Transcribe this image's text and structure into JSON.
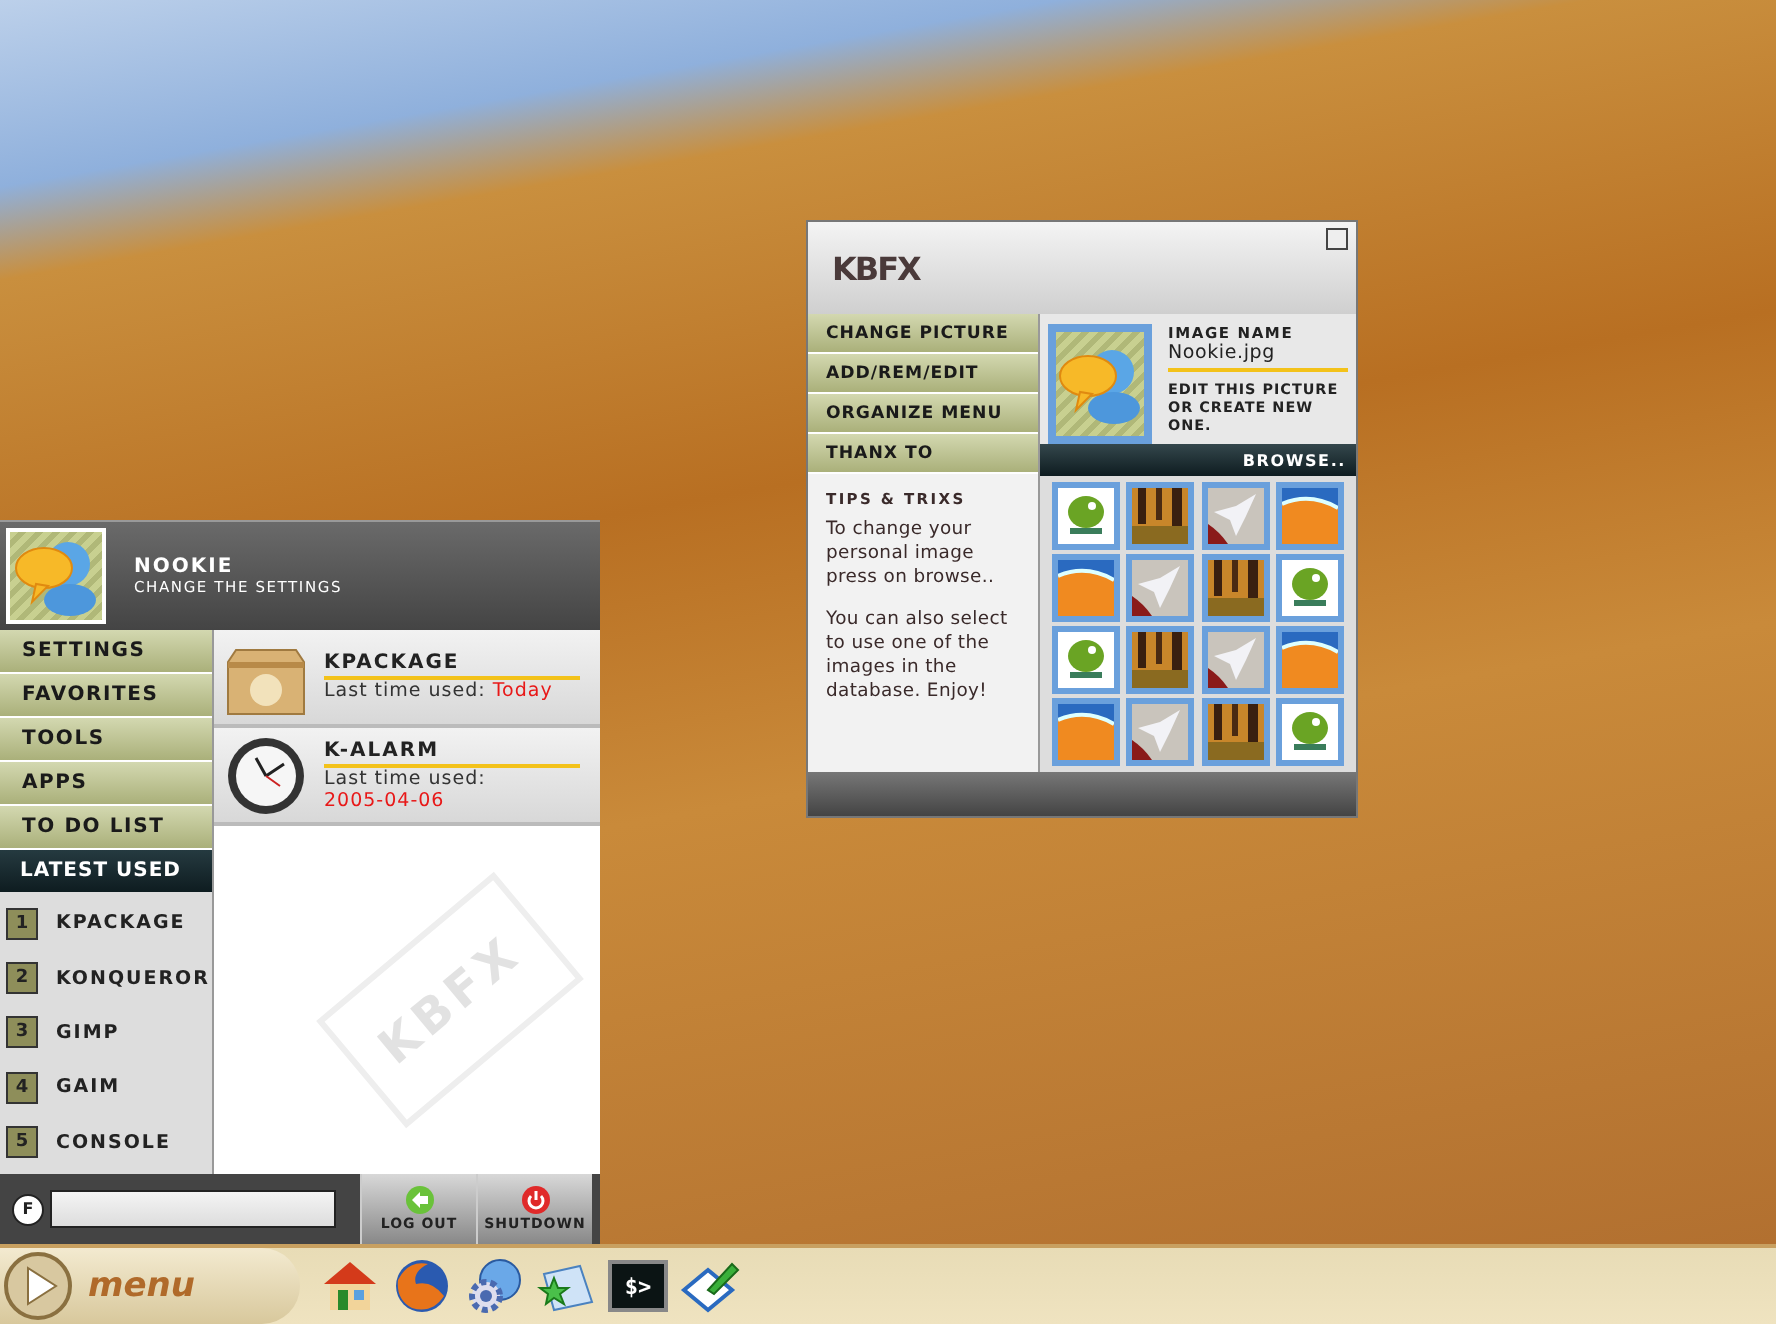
{
  "menu": {
    "user": {
      "name": "NOOKIE",
      "subtitle": "CHANGE THE SETTINGS"
    },
    "categories": [
      {
        "label": "SETTINGS"
      },
      {
        "label": "FAVORITES"
      },
      {
        "label": "TOOLS"
      },
      {
        "label": "APPS"
      },
      {
        "label": "TO DO LIST"
      }
    ],
    "latest_used": {
      "title": "LATEST USED",
      "items": [
        {
          "number": "1",
          "label": "KPACKAGE"
        },
        {
          "number": "2",
          "label": "KONQUEROR"
        },
        {
          "number": "3",
          "label": "GIMP"
        },
        {
          "number": "4",
          "label": "GAIM"
        },
        {
          "number": "5",
          "label": "CONSOLE"
        }
      ]
    },
    "entries": [
      {
        "kind": "package",
        "name": "KPACKAGE",
        "caption": "Last time used:",
        "when": "Today"
      },
      {
        "kind": "clock",
        "name": "K-ALARM",
        "caption": "Last time used:",
        "when": "2005-04-06"
      }
    ],
    "watermark_text": "KBFX",
    "search": {
      "badge": "F"
    },
    "buttons": [
      {
        "kind": "logout",
        "label": "LOG OUT"
      },
      {
        "kind": "shutdown",
        "label": "SHUTDOWN"
      }
    ]
  },
  "config": {
    "logo": "KBFX",
    "actions": [
      "CHANGE PICTURE",
      "ADD/REM/EDIT",
      "ORGANIZE MENU",
      "THANX TO"
    ],
    "tips": {
      "title": "TIPS & TRIXS",
      "paragraphs": [
        "To change your personal image press on browse..",
        "You can also select to use one of the images in the database. Enjoy!"
      ]
    },
    "image": {
      "title": "IMAGE NAME",
      "file": "Nookie.jpg",
      "note": "EDIT THIS PICTURE OR CREATE NEW ONE."
    },
    "browse": "BROWSE..",
    "thumbnails": [
      {
        "kind": "lizard"
      },
      {
        "kind": "forest"
      },
      {
        "kind": "bird"
      },
      {
        "kind": "fox"
      },
      {
        "kind": "fox"
      },
      {
        "kind": "bird"
      },
      {
        "kind": "forest"
      },
      {
        "kind": "lizard"
      },
      {
        "kind": "lizard"
      },
      {
        "kind": "forest"
      },
      {
        "kind": "bird"
      },
      {
        "kind": "fox"
      },
      {
        "kind": "fox"
      },
      {
        "kind": "bird"
      },
      {
        "kind": "forest"
      },
      {
        "kind": "lizard"
      }
    ]
  },
  "taskbar": {
    "start_label": "menu",
    "launchers": [
      {
        "kind": "home"
      },
      {
        "kind": "browser"
      },
      {
        "kind": "network"
      },
      {
        "kind": "bookmarks"
      },
      {
        "kind": "terminal",
        "glyph": "$>"
      },
      {
        "kind": "editor"
      }
    ]
  }
}
